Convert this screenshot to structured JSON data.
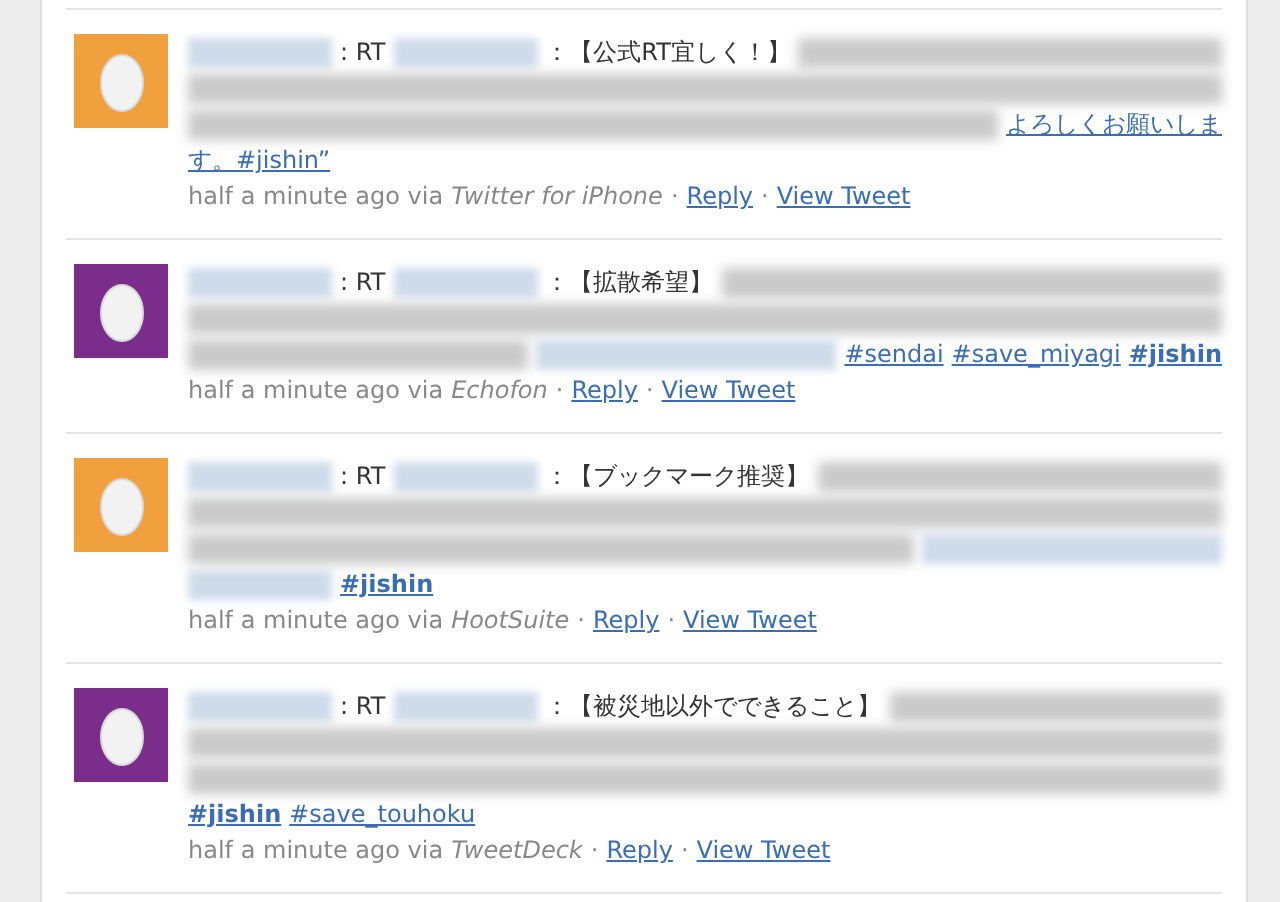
{
  "tweets": [
    {
      "color": "#f0a03c",
      "lines": [
        [
          {
            "kind": "name_blur"
          },
          {
            "kind": "text",
            "text": ": RT"
          },
          {
            "kind": "name_blur"
          },
          {
            "kind": "text",
            "text": "：【公式RT宜しく！】"
          },
          {
            "kind": "rest_blur"
          }
        ],
        [
          {
            "kind": "rest_blur"
          }
        ],
        [
          {
            "kind": "rest_blur"
          },
          {
            "kind": "link",
            "text": "よろしくお願いしま",
            "bold": false
          }
        ],
        [
          {
            "kind": "link",
            "text": "す。#jishin”",
            "bold": false
          }
        ]
      ],
      "meta": {
        "time": "half a minute ago via",
        "client": "Twitter for iPhone",
        "sep1": "·",
        "reply": "Reply",
        "sep2": "·",
        "view": "View Tweet"
      }
    },
    {
      "color": "#7b2d8b",
      "lines": [
        [
          {
            "kind": "name_blur"
          },
          {
            "kind": "text",
            "text": ": RT"
          },
          {
            "kind": "name_blur"
          },
          {
            "kind": "text",
            "text": "：【拡散希望】"
          },
          {
            "kind": "rest_blur"
          }
        ],
        [
          {
            "kind": "rest_blur"
          }
        ],
        [
          {
            "kind": "rest_blur"
          },
          {
            "kind": "link_blur"
          },
          {
            "kind": "link",
            "text": "#sendai",
            "bold": false
          },
          {
            "kind": "link",
            "text": "#save_miyagi",
            "bold": false
          },
          {
            "kind": "link",
            "text": "#jishin",
            "bold": true
          }
        ]
      ],
      "meta": {
        "time": "half a minute ago via",
        "client": "Echofon",
        "sep1": "·",
        "reply": "Reply",
        "sep2": "·",
        "view": "View Tweet"
      }
    },
    {
      "color": "#f0a03c",
      "lines": [
        [
          {
            "kind": "name_blur"
          },
          {
            "kind": "text",
            "text": ": RT"
          },
          {
            "kind": "name_blur"
          },
          {
            "kind": "text",
            "text": "：【ブックマーク推奨】"
          },
          {
            "kind": "rest_blur"
          }
        ],
        [
          {
            "kind": "rest_blur"
          }
        ],
        [
          {
            "kind": "rest_blur"
          },
          {
            "kind": "link_blur"
          }
        ],
        [
          {
            "kind": "name_blur"
          },
          {
            "kind": "link",
            "text": "#jishin",
            "bold": true
          }
        ]
      ],
      "meta": {
        "time": "half a minute ago via",
        "client": "HootSuite",
        "sep1": "·",
        "reply": "Reply",
        "sep2": "·",
        "view": "View Tweet"
      }
    },
    {
      "color": "#7b2d8b",
      "lines": [
        [
          {
            "kind": "name_blur"
          },
          {
            "kind": "text",
            "text": ": RT"
          },
          {
            "kind": "name_blur"
          },
          {
            "kind": "text",
            "text": "：【被災地以外でできること】"
          },
          {
            "kind": "rest_blur"
          }
        ],
        [
          {
            "kind": "rest_blur"
          }
        ],
        [
          {
            "kind": "rest_blur"
          }
        ],
        [
          {
            "kind": "link",
            "text": "#jishin",
            "bold": true
          },
          {
            "kind": "link",
            "text": "#save_touhoku",
            "bold": false
          }
        ]
      ],
      "meta": {
        "time": "half a minute ago via",
        "client": "TweetDeck",
        "sep1": "·",
        "reply": "Reply",
        "sep2": "·",
        "view": "View Tweet"
      }
    }
  ]
}
